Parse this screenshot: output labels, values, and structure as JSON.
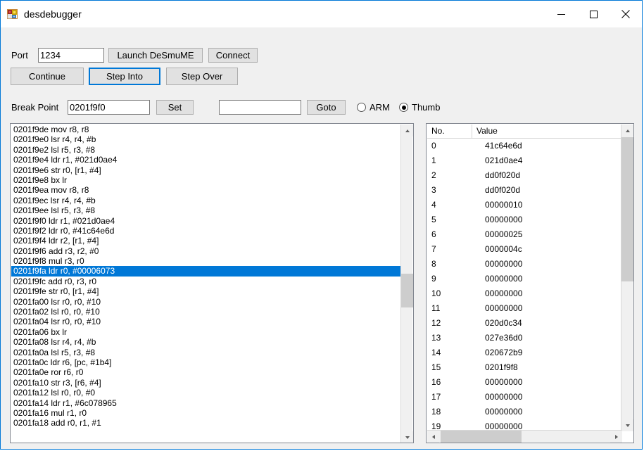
{
  "window": {
    "title": "desdebugger",
    "icon": "winforms-app-icon",
    "accent_color": "#0078d7",
    "controls": [
      {
        "name": "minimize-button",
        "glyph": "minimize-icon",
        "label": "Minimize"
      },
      {
        "name": "maximize-button",
        "glyph": "maximize-icon",
        "label": "Maximize"
      },
      {
        "name": "close-button",
        "glyph": "close-icon",
        "label": "Close"
      }
    ]
  },
  "toolbar": {
    "port_label": "Port",
    "port_value": "1234",
    "launch_label": "Launch DeSmuME",
    "connect_label": "Connect",
    "continue_label": "Continue",
    "step_into_label": "Step Into",
    "step_over_label": "Step Over",
    "breakpoint_label": "Break Point",
    "breakpoint_value": "0201f9f0",
    "set_label": "Set",
    "goto_value": "",
    "goto_label": "Goto",
    "mode_arm_label": "ARM",
    "mode_thumb_label": "Thumb",
    "mode_selected": "Thumb"
  },
  "disassembly": {
    "selected_index": 14,
    "lines": [
      "0201f9de mov r8, r8",
      "0201f9e0 lsr r4, r4, #b",
      "0201f9e2 lsl r5, r3, #8",
      "0201f9e4 ldr r1, #021d0ae4",
      "0201f9e6 str r0, [r1, #4]",
      "0201f9e8 bx lr",
      "0201f9ea mov r8, r8",
      "0201f9ec lsr r4, r4, #b",
      "0201f9ee lsl r5, r3, #8",
      "0201f9f0 ldr r1, #021d0ae4",
      "0201f9f2 ldr r0, #41c64e6d",
      "0201f9f4 ldr r2, [r1, #4]",
      "0201f9f6 add r3, r2, #0",
      "0201f9f8 mul r3, r0",
      "0201f9fa ldr r0, #00006073",
      "0201f9fc add r0, r3, r0",
      "0201f9fe str r0, [r1, #4]",
      "0201fa00 lsr r0, r0, #10",
      "0201fa02 lsl r0, r0, #10",
      "0201fa04 lsr r0, r0, #10",
      "0201fa06 bx lr",
      "0201fa08 lsr r4, r4, #b",
      "0201fa0a lsl r5, r3, #8",
      "0201fa0c ldr r6, [pc, #1b4]",
      "0201fa0e ror r6, r0",
      "0201fa10 str r3, [r6, #4]",
      "0201fa12 lsl r0, r0, #0",
      "0201fa14 ldr r1, #6c078965",
      "0201fa16 mul r1, r0",
      "0201fa18 add r0, r1, #1"
    ]
  },
  "registers": {
    "columns": [
      "No.",
      "Value"
    ],
    "rows": [
      {
        "no": "0",
        "value": "41c64e6d"
      },
      {
        "no": "1",
        "value": "021d0ae4"
      },
      {
        "no": "2",
        "value": "dd0f020d"
      },
      {
        "no": "3",
        "value": "dd0f020d"
      },
      {
        "no": "4",
        "value": "00000010"
      },
      {
        "no": "5",
        "value": "00000000"
      },
      {
        "no": "6",
        "value": "00000025"
      },
      {
        "no": "7",
        "value": "0000004c"
      },
      {
        "no": "8",
        "value": "00000000"
      },
      {
        "no": "9",
        "value": "00000000"
      },
      {
        "no": "10",
        "value": "00000000"
      },
      {
        "no": "11",
        "value": "00000000"
      },
      {
        "no": "12",
        "value": "020d0c34"
      },
      {
        "no": "13",
        "value": "027e36d0"
      },
      {
        "no": "14",
        "value": "020672b9"
      },
      {
        "no": "15",
        "value": "0201f9f8"
      },
      {
        "no": "16",
        "value": "00000000"
      },
      {
        "no": "17",
        "value": "00000000"
      },
      {
        "no": "18",
        "value": "00000000"
      },
      {
        "no": "19",
        "value": "00000000"
      }
    ]
  }
}
